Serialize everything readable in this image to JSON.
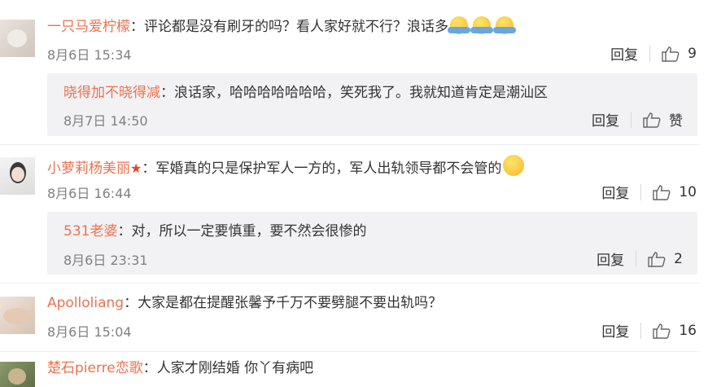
{
  "comments": [
    {
      "user": "一只马爱柠檬",
      "colon": "：",
      "text": "评论都是没有刷牙的吗？看人家好就不行？浪话多",
      "emoji": "hug-emoji",
      "time": "8月6日 15:34",
      "reply_label": "回复",
      "likes": "9",
      "subreply": {
        "user": "晓得加不晓得减",
        "colon": "：",
        "text": "浪话家，哈哈哈哈哈哈哈，笑死我了。我就知道肯定是潮汕区",
        "time": "8月7日 14:50",
        "reply_label": "回复",
        "likes": "赞"
      }
    },
    {
      "user": "小萝莉杨美丽",
      "badge": "★",
      "colon": "：",
      "text": "军婚真的只是保护军人一方的，军人出轨领导都不会管的",
      "emoji": "thinking-emoji",
      "time": "8月6日 16:44",
      "reply_label": "回复",
      "likes": "10",
      "subreply": {
        "user": "531老婆",
        "colon": "：",
        "text": "对，所以一定要慎重，要不然会很惨的",
        "time": "8月6日 23:31",
        "reply_label": "回复",
        "likes": "2"
      }
    },
    {
      "user": "Apolloliang",
      "colon": "：",
      "text": "大家是都在提醒张馨予千万不要劈腿不要出轨吗？",
      "time": "8月6日 15:04",
      "reply_label": "回复",
      "likes": "16"
    },
    {
      "user": "楚石pierre恋歌",
      "colon": "：",
      "text": "人家才刚结婚 你丫有病吧"
    }
  ],
  "colors": {
    "username": "#eb7350",
    "time": "#808080",
    "subreply_bg": "#f2f2f5"
  }
}
